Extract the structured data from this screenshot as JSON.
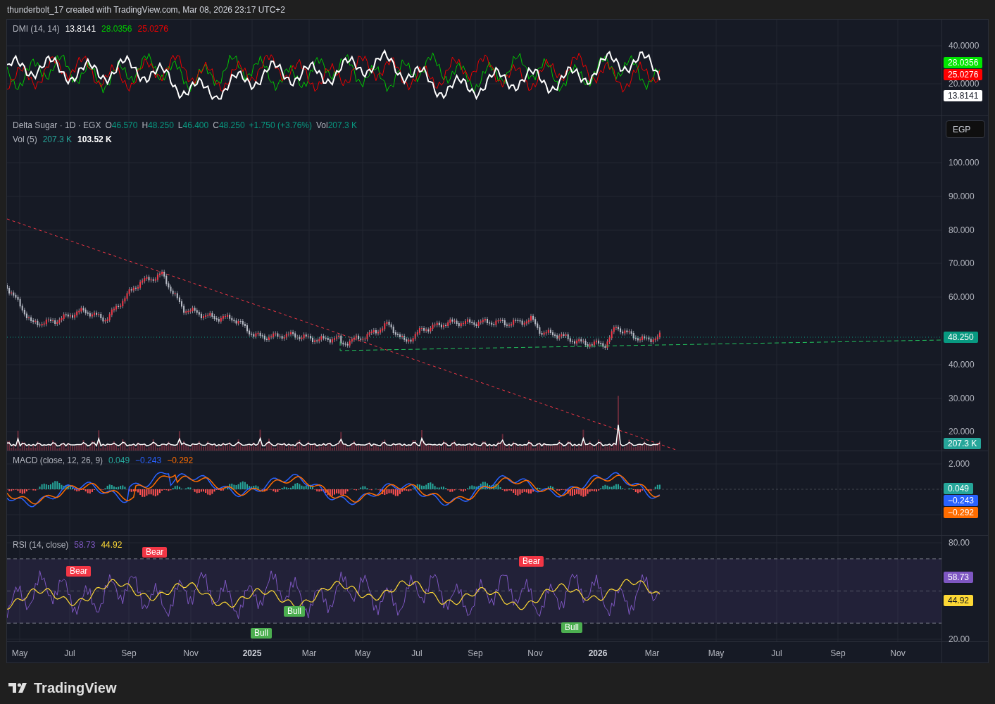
{
  "caption": "thunderbolt_17 created with TradingView.com, Mar 08, 2026 23:17 UTC+2",
  "dmi": {
    "title": "DMI (14, 14)",
    "values": [
      {
        "text": "13.8141",
        "color": "#ffffff"
      },
      {
        "text": "28.0356",
        "color": "#00c800"
      },
      {
        "text": "25.0276",
        "color": "#f00000"
      }
    ],
    "ticks": [
      "40.0000",
      "20.0000"
    ],
    "tags": [
      {
        "text": "28.0356",
        "color": "#00e600"
      },
      {
        "text": "25.0276",
        "color": "#ff0000"
      },
      {
        "text": "13.8141",
        "color": "#ffffff"
      }
    ]
  },
  "price": {
    "symbol": "Delta Sugar · 1D · EGX",
    "ohlc": [
      {
        "label": "O",
        "value": "46.570"
      },
      {
        "label": "H",
        "value": "48.250"
      },
      {
        "label": "L",
        "value": "46.400"
      },
      {
        "label": "C",
        "value": "48.250"
      }
    ],
    "change": "+1.750 (+3.76%)",
    "volume": {
      "label": "Vol",
      "value": "207.3 K"
    },
    "vol_ma": {
      "title": "Vol (5)",
      "values": [
        {
          "text": "207.3 K",
          "color": "#26a69a"
        },
        {
          "text": "103.52 K",
          "color": "#ffffff"
        }
      ]
    },
    "currency": "EGP",
    "ticks": [
      "100.000",
      "90.000",
      "80.000",
      "70.000",
      "60.000",
      "40.000",
      "30.000",
      "20.000"
    ],
    "tags": [
      {
        "text": "48.250",
        "color": "#089981"
      },
      {
        "text": "207.3 K",
        "color": "#26a69a"
      }
    ]
  },
  "macd": {
    "title": "MACD (close, 12, 26, 9)",
    "values": [
      {
        "text": "0.049",
        "color": "#26a69a"
      },
      {
        "text": "−0.243",
        "color": "#2962ff"
      },
      {
        "text": "−0.292",
        "color": "#ff6d00"
      }
    ],
    "ticks": [
      "2.000"
    ],
    "tags": [
      {
        "text": "0.049",
        "color": "#26a69a"
      },
      {
        "text": "−0.243",
        "color": "#2962ff"
      },
      {
        "text": "−0.292",
        "color": "#ff6d00"
      }
    ]
  },
  "rsi": {
    "title": "RSI (14, close)",
    "values": [
      {
        "text": "58.73",
        "color": "#7e57c2"
      },
      {
        "text": "44.92",
        "color": "#fdd835"
      }
    ],
    "ticks": [
      "80.00",
      "20.00"
    ],
    "tags": [
      {
        "text": "58.73",
        "color": "#7e57c2"
      },
      {
        "text": "44.92",
        "color": "#fdd835"
      }
    ],
    "signals": [
      {
        "kind": "bear",
        "text": "Bear"
      },
      {
        "kind": "bear",
        "text": "Bear"
      },
      {
        "kind": "bull",
        "text": "Bull"
      },
      {
        "kind": "bull",
        "text": "Bull"
      },
      {
        "kind": "bear",
        "text": "Bear"
      },
      {
        "kind": "bull",
        "text": "Bull"
      }
    ]
  },
  "time_axis": [
    {
      "text": "May",
      "kind": "month"
    },
    {
      "text": "Jul",
      "kind": "month"
    },
    {
      "text": "Sep",
      "kind": "month"
    },
    {
      "text": "Nov",
      "kind": "month"
    },
    {
      "text": "2025",
      "kind": "year"
    },
    {
      "text": "Mar",
      "kind": "month"
    },
    {
      "text": "May",
      "kind": "month"
    },
    {
      "text": "Jul",
      "kind": "month"
    },
    {
      "text": "Sep",
      "kind": "month"
    },
    {
      "text": "Nov",
      "kind": "month"
    },
    {
      "text": "2026",
      "kind": "year"
    },
    {
      "text": "Mar",
      "kind": "month"
    },
    {
      "text": "May",
      "kind": "month"
    },
    {
      "text": "Jul",
      "kind": "month"
    },
    {
      "text": "Sep",
      "kind": "month"
    },
    {
      "text": "Nov",
      "kind": "month"
    }
  ],
  "footer": {
    "brand": "TradingView"
  }
}
